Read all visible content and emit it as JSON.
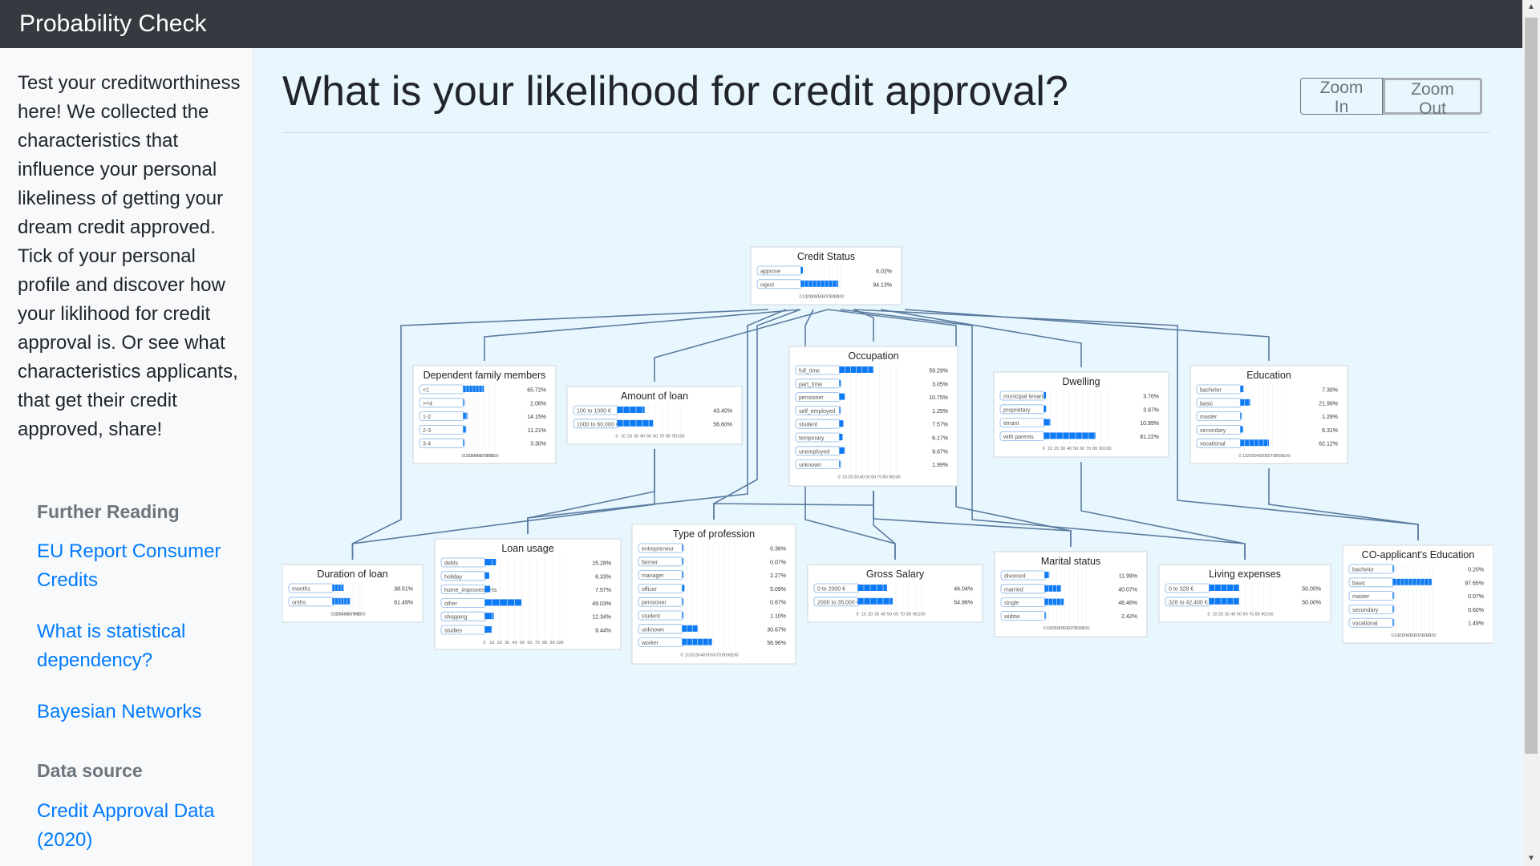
{
  "navbar": {
    "brand": "Probability Check"
  },
  "sidebar": {
    "intro": "Test your creditworthiness here! We collected the characteristics that influence your personal likeliness of getting your dream credit approved. Tick of your personal profile and discover how your liklihood for credit approval is. Or see what characteristics applicants, that get their credit approved, share!",
    "further_reading_heading": "Further Reading",
    "links": [
      "EU Report Consumer Credits",
      "What is statistical dependency?",
      "Bayesian Networks"
    ],
    "data_source_heading": "Data source",
    "data_link": "Credit Approval Data (2020)"
  },
  "main": {
    "title": "What is your likelihood for credit approval?",
    "zoom_in": "Zoom In",
    "zoom_out": "Zoom Out"
  },
  "colors": {
    "bar": "#0d7af5",
    "edge": "#5a7ba0",
    "node_border": "#cfd6dc"
  },
  "axis_ticks": [
    "0",
    "10",
    "20",
    "30",
    "40",
    "50",
    "60",
    "70",
    "80",
    "90",
    "100"
  ],
  "network": {
    "nodes": [
      {
        "id": "credit_status",
        "title": "Credit Status",
        "rows": [
          [
            "approve",
            6.02,
            "6.02%"
          ],
          [
            "reject",
            94.13,
            "94.13%"
          ]
        ]
      },
      {
        "id": "dependents",
        "title": "Dependent family members",
        "rows": [
          [
            "<1",
            65.72,
            "65.72%"
          ],
          [
            ">=4",
            2.06,
            "2.06%"
          ],
          [
            "1-2",
            14.15,
            "14.15%"
          ],
          [
            "2-3",
            11.21,
            "11.21%"
          ],
          [
            "3-4",
            3.3,
            "3.30%"
          ]
        ]
      },
      {
        "id": "amount",
        "title": "Amount of loan",
        "rows": [
          [
            "100 to 1000 €",
            43.4,
            "43.40%"
          ],
          [
            "1000 to 60,000 €",
            56.6,
            "56.60%"
          ]
        ]
      },
      {
        "id": "occupation",
        "title": "Occupation",
        "rows": [
          [
            "full_time",
            59.29,
            "59.29%"
          ],
          [
            "part_time",
            3.05,
            "3.05%"
          ],
          [
            "pensioner",
            10.75,
            "10.75%"
          ],
          [
            "self_employed",
            1.25,
            "1.25%"
          ],
          [
            "student",
            7.57,
            "7.57%"
          ],
          [
            "temporary",
            6.17,
            "6.17%"
          ],
          [
            "unemployed",
            9.67,
            "9.67%"
          ],
          [
            "unknown",
            1.99,
            "1.99%"
          ]
        ]
      },
      {
        "id": "dwelling",
        "title": "Dwelling",
        "rows": [
          [
            "municipal tenant",
            3.76,
            "3.76%"
          ],
          [
            "proprietary",
            3.97,
            "3.97%"
          ],
          [
            "tenant",
            10.99,
            "10.99%"
          ],
          [
            "with parents",
            81.22,
            "81.22%"
          ]
        ]
      },
      {
        "id": "education",
        "title": "Education",
        "rows": [
          [
            "bachelor",
            7.3,
            "7.30%"
          ],
          [
            "basic",
            21.99,
            "21.99%"
          ],
          [
            "master",
            1.28,
            "1.28%"
          ],
          [
            "secondary",
            6.31,
            "6.31%"
          ],
          [
            "vocational",
            62.12,
            "62.12%"
          ]
        ]
      },
      {
        "id": "duration",
        "title": "Duration of loan",
        "rows": [
          [
            "months",
            38.51,
            "38.51%"
          ],
          [
            "onths",
            61.49,
            "61.49%"
          ]
        ]
      },
      {
        "id": "usage",
        "title": "Loan usage",
        "rows": [
          [
            "debts",
            15.28,
            "15.28%"
          ],
          [
            "holiday",
            6.33,
            "6.33%"
          ],
          [
            "home_improvements",
            7.57,
            "7.57%"
          ],
          [
            "other",
            49.03,
            "49.03%"
          ],
          [
            "shopping",
            12.34,
            "12.34%"
          ],
          [
            "studies",
            9.44,
            "9.44%"
          ]
        ]
      },
      {
        "id": "profession",
        "title": "Type of profession",
        "rows": [
          [
            "entrepreneur",
            0.36,
            "0.36%"
          ],
          [
            "farmer",
            0.07,
            "0.07%"
          ],
          [
            "manager",
            2.27,
            "2.27%"
          ],
          [
            "officer",
            5.09,
            "5.09%"
          ],
          [
            "pensioner",
            0.67,
            "0.67%"
          ],
          [
            "student",
            1.1,
            "1.10%"
          ],
          [
            "unknown",
            30.67,
            "30.67%"
          ],
          [
            "worker",
            56.96,
            "56.96%"
          ]
        ]
      },
      {
        "id": "salary",
        "title": "Gross Salary",
        "rows": [
          [
            "0 to 2000 €",
            46.04,
            "46.04%"
          ],
          [
            "2000 to 35,000 €",
            54.96,
            "54.96%"
          ]
        ]
      },
      {
        "id": "marital",
        "title": "Marital status",
        "rows": [
          [
            "divorced",
            11.99,
            "11.99%"
          ],
          [
            "married",
            40.07,
            "40.07%"
          ],
          [
            "single",
            46.46,
            "46.46%"
          ],
          [
            "widow",
            2.42,
            "2.42%"
          ]
        ]
      },
      {
        "id": "living",
        "title": "Living expenses",
        "rows": [
          [
            "0 to 328 €",
            50.0,
            "50.00%"
          ],
          [
            "328 to 42,400 €",
            50.0,
            "50.00%"
          ]
        ]
      },
      {
        "id": "coeducation",
        "title": "CO-applicant's Education",
        "rows": [
          [
            "bachelor",
            0.2,
            "0.20%"
          ],
          [
            "basic",
            97.65,
            "97.65%"
          ],
          [
            "master",
            0.07,
            "0.07%"
          ],
          [
            "secondary",
            0.6,
            "0.60%"
          ],
          [
            "vocational",
            1.49,
            "1.49%"
          ]
        ]
      }
    ]
  }
}
